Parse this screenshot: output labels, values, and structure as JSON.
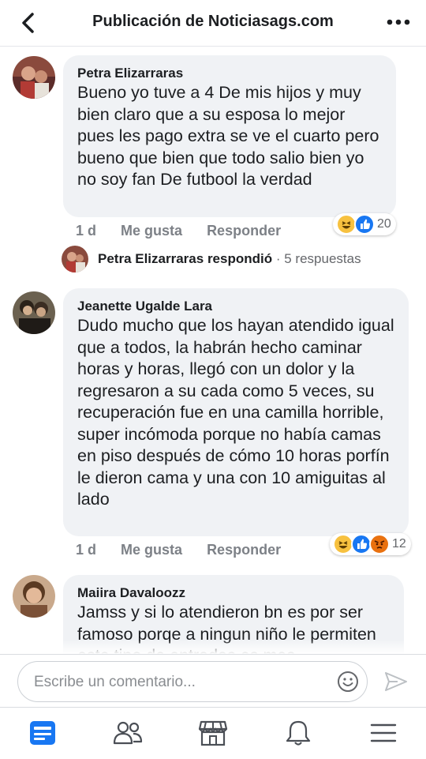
{
  "header": {
    "title": "Publicación de Noticiasags.com"
  },
  "comments": [
    {
      "name": "Petra Elizarraras",
      "text": "Bueno yo tuve a 4 De mis hijos y muy bien claro  que a su esposa lo mejor pues les pago extra se ve  el cuarto pero bueno que bien que todo  salio bien yo no soy fan De futbool la verdad",
      "time": "1 d",
      "like_label": "Me gusta",
      "reply_label": "Responder",
      "reaction_count": "20",
      "reactions": [
        "haha",
        "like"
      ],
      "reply": {
        "name": "Petra Elizarraras",
        "verb": "respondió",
        "separator": "·",
        "count": "5 respuestas"
      }
    },
    {
      "name": "Jeanette Ugalde Lara",
      "text": "Dudo mucho que los hayan atendido igual que a todos, la habrán hecho caminar horas y horas, llegó con un dolor y la regresaron a su cada como 5 veces, su recuperación fue en una camilla horrible, super incómoda porque no había camas en piso después de cómo 10 horas porfín le dieron cama y una con 10 amiguitas al lado",
      "time": "1 d",
      "like_label": "Me gusta",
      "reply_label": "Responder",
      "reaction_count": "12",
      "reactions": [
        "haha",
        "like",
        "angry"
      ]
    },
    {
      "name": "Maiira Davaloozz",
      "text": "Jamss y si lo atendieron bn es por ser famoso porqe a ningun niño le permiten este tipo de entradas es mas"
    }
  ],
  "composer": {
    "placeholder": "Escribe un comentario..."
  },
  "colors": {
    "like": "#1877f2",
    "haha": "#f7c13f",
    "angry": "#e9710f",
    "bubble": "#f0f2f5",
    "active_tab": "#1877f2"
  },
  "tabs": [
    "news-feed-icon",
    "friends-icon",
    "marketplace-icon",
    "notifications-icon",
    "menu-icon"
  ]
}
